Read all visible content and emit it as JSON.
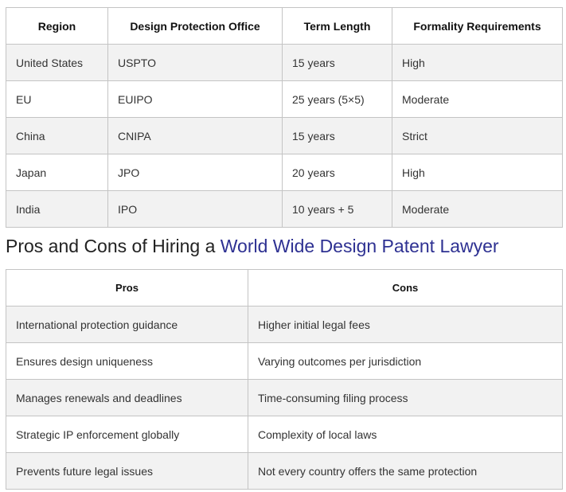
{
  "table1": {
    "headers": [
      "Region",
      "Design Protection Office",
      "Term Length",
      "Formality Requirements"
    ],
    "rows": [
      [
        "United States",
        "USPTO",
        "15 years",
        "High"
      ],
      [
        "EU",
        "EUIPO",
        "25 years (5×5)",
        "Moderate"
      ],
      [
        "China",
        "CNIPA",
        "15 years",
        "Strict"
      ],
      [
        "Japan",
        "JPO",
        "20 years",
        "High"
      ],
      [
        "India",
        "IPO",
        "10 years + 5",
        "Moderate"
      ]
    ]
  },
  "heading": {
    "prefix": "Pros and Cons of Hiring a ",
    "link": "World Wide Design Patent Lawyer"
  },
  "table2": {
    "headers": [
      "Pros",
      "Cons"
    ],
    "rows": [
      [
        "International protection guidance",
        "Higher initial legal fees"
      ],
      [
        "Ensures design uniqueness",
        "Varying outcomes per jurisdiction"
      ],
      [
        "Manages renewals and deadlines",
        "Time-consuming filing process"
      ],
      [
        "Strategic IP enforcement globally",
        "Complexity of local laws"
      ],
      [
        "Prevents future legal issues",
        "Not every country offers the same protection"
      ]
    ]
  }
}
